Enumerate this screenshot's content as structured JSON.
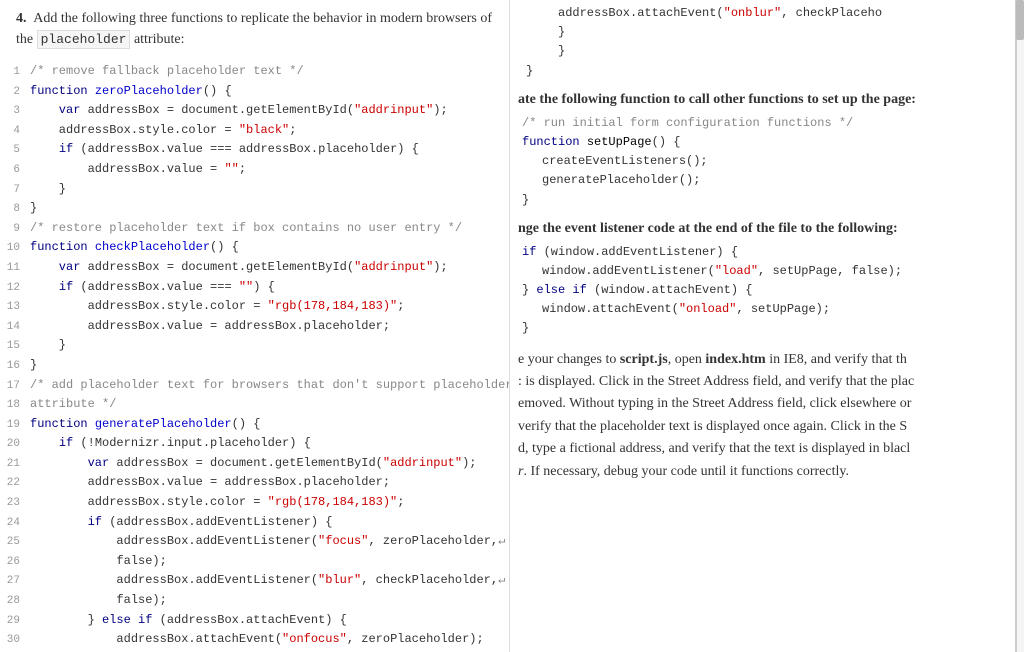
{
  "left": {
    "intro": {
      "step": "4.",
      "text1": "Add the following three functions to replicate the behavior in modern browsers of the",
      "code_word": "placeholder",
      "text2": "attribute:"
    },
    "lines": [
      {
        "num": "1",
        "tokens": [
          {
            "t": "/* remove fallback placeholder text */",
            "c": "cm"
          }
        ]
      },
      {
        "num": "2",
        "tokens": [
          {
            "t": "function ",
            "c": "kw"
          },
          {
            "t": "zeroPlaceholder",
            "c": "fn"
          },
          {
            "t": "() {",
            "c": ""
          }
        ]
      },
      {
        "num": "3",
        "tokens": [
          {
            "t": "    var ",
            "c": "kw"
          },
          {
            "t": "addressBox",
            "c": ""
          },
          {
            "t": " = ",
            "c": ""
          },
          {
            "t": "document",
            "c": ""
          },
          {
            "t": ".getElementById(",
            "c": ""
          },
          {
            "t": "\"addrinput\"",
            "c": "str"
          },
          {
            "t": ");",
            "c": ""
          }
        ]
      },
      {
        "num": "4",
        "tokens": [
          {
            "t": "    addressBox.style.color = ",
            "c": ""
          },
          {
            "t": "\"black\"",
            "c": "str"
          },
          {
            "t": ";",
            "c": ""
          }
        ]
      },
      {
        "num": "5",
        "tokens": [
          {
            "t": "    ",
            "c": ""
          },
          {
            "t": "if",
            "c": "kw"
          },
          {
            "t": " (addressBox.value ",
            "c": ""
          },
          {
            "t": "===",
            "c": ""
          },
          {
            "t": " addressBox.placeholder) {",
            "c": ""
          }
        ]
      },
      {
        "num": "6",
        "tokens": [
          {
            "t": "        addressBox.value = ",
            "c": ""
          },
          {
            "t": "\"\"",
            "c": "str"
          },
          {
            "t": ";",
            "c": ""
          }
        ]
      },
      {
        "num": "7",
        "tokens": [
          {
            "t": "    }",
            "c": ""
          }
        ]
      },
      {
        "num": "8",
        "tokens": [
          {
            "t": "}",
            "c": ""
          }
        ]
      },
      {
        "num": "9",
        "tokens": [
          {
            "t": "/* restore placeholder text if box contains no user entry */",
            "c": "cm"
          }
        ]
      },
      {
        "num": "10",
        "tokens": [
          {
            "t": "function ",
            "c": "kw"
          },
          {
            "t": "checkPlaceholder",
            "c": "fn"
          },
          {
            "t": "() {",
            "c": ""
          }
        ]
      },
      {
        "num": "11",
        "tokens": [
          {
            "t": "    var ",
            "c": "kw"
          },
          {
            "t": "addressBox",
            "c": ""
          },
          {
            "t": " = ",
            "c": ""
          },
          {
            "t": "document",
            "c": ""
          },
          {
            "t": ".getElementById(",
            "c": ""
          },
          {
            "t": "\"addrinput\"",
            "c": "str"
          },
          {
            "t": ");",
            "c": ""
          }
        ]
      },
      {
        "num": "12",
        "tokens": [
          {
            "t": "    ",
            "c": ""
          },
          {
            "t": "if",
            "c": "kw"
          },
          {
            "t": " (addressBox.value ",
            "c": ""
          },
          {
            "t": "===",
            "c": ""
          },
          {
            "t": " ",
            "c": ""
          },
          {
            "t": "\"\"",
            "c": "str"
          },
          {
            "t": ") {",
            "c": ""
          }
        ]
      },
      {
        "num": "13",
        "tokens": [
          {
            "t": "        addressBox.style.color = ",
            "c": ""
          },
          {
            "t": "\"rgb(178,184,183)\"",
            "c": "str"
          },
          {
            "t": ";",
            "c": ""
          }
        ]
      },
      {
        "num": "14",
        "tokens": [
          {
            "t": "        addressBox.value = addressBox.placeholder;",
            "c": ""
          }
        ]
      },
      {
        "num": "15",
        "tokens": [
          {
            "t": "    }",
            "c": ""
          }
        ]
      },
      {
        "num": "16",
        "tokens": [
          {
            "t": "}",
            "c": ""
          }
        ]
      },
      {
        "num": "17",
        "tokens": [
          {
            "t": "/* add placeholder text for browsers that don't support placeholder",
            "c": "cm"
          }
        ]
      },
      {
        "num": "18",
        "tokens": [
          {
            "t": "attribute */",
            "c": "cm"
          }
        ]
      },
      {
        "num": "19",
        "tokens": [
          {
            "t": "function ",
            "c": "kw"
          },
          {
            "t": "generatePlaceholder",
            "c": "fn"
          },
          {
            "t": "() {",
            "c": ""
          }
        ]
      },
      {
        "num": "20",
        "tokens": [
          {
            "t": "    ",
            "c": ""
          },
          {
            "t": "if",
            "c": "kw"
          },
          {
            "t": " (!Modernizr.input.placeholder) {",
            "c": ""
          }
        ]
      },
      {
        "num": "21",
        "tokens": [
          {
            "t": "        var ",
            "c": "kw"
          },
          {
            "t": "addressBox",
            "c": ""
          },
          {
            "t": " = ",
            "c": ""
          },
          {
            "t": "document",
            "c": ""
          },
          {
            "t": ".getElementById(",
            "c": ""
          },
          {
            "t": "\"addrinput\"",
            "c": "str"
          },
          {
            "t": ");",
            "c": ""
          }
        ]
      },
      {
        "num": "22",
        "tokens": [
          {
            "t": "        addressBox.value = addressBox.placeholder;",
            "c": ""
          }
        ]
      },
      {
        "num": "23",
        "tokens": [
          {
            "t": "        addressBox.style.color = ",
            "c": ""
          },
          {
            "t": "\"rgb(178,184,183)\"",
            "c": "str"
          },
          {
            "t": ";",
            "c": ""
          }
        ]
      },
      {
        "num": "24",
        "tokens": [
          {
            "t": "        ",
            "c": ""
          },
          {
            "t": "if",
            "c": "kw"
          },
          {
            "t": " (addressBox.addEventListener) {",
            "c": ""
          }
        ]
      },
      {
        "num": "25",
        "tokens": [
          {
            "t": "            addressBox.addEventListener(",
            "c": ""
          },
          {
            "t": "\"focus\"",
            "c": "str"
          },
          {
            "t": ", zeroPlaceholder,",
            "c": ""
          },
          {
            "t": "↵",
            "c": "cm"
          }
        ]
      },
      {
        "num": "26",
        "tokens": [
          {
            "t": "            false);",
            "c": ""
          }
        ]
      },
      {
        "num": "27",
        "tokens": [
          {
            "t": "            addressBox.addEventListener(",
            "c": ""
          },
          {
            "t": "\"blur\"",
            "c": "str"
          },
          {
            "t": ", checkPlaceholder,",
            "c": ""
          },
          {
            "t": "↵",
            "c": "cm"
          }
        ]
      },
      {
        "num": "28",
        "tokens": [
          {
            "t": "            false);",
            "c": ""
          }
        ]
      },
      {
        "num": "29",
        "tokens": [
          {
            "t": "        } ",
            "c": ""
          },
          {
            "t": "else if",
            "c": "kw"
          },
          {
            "t": " (addressBox.attachEvent) {",
            "c": ""
          }
        ]
      },
      {
        "num": "30",
        "tokens": [
          {
            "t": "            addressBox.attachEvent(",
            "c": ""
          },
          {
            "t": "\"onfocus\"",
            "c": "str"
          },
          {
            "t": ", zeroPlaceholder);",
            "c": ""
          }
        ]
      }
    ]
  },
  "right": {
    "code_top": [
      "            addressBox.attachEvent(\"onblur\", checkPlaceho",
      "        }",
      "    }",
      "}"
    ],
    "section1_heading": "ate the following function to call other functions to set up the page:",
    "section1_code": [
      {
        "indent": 0,
        "tokens": [
          {
            "t": "/* run initial form configuration functions */",
            "c": "cm"
          }
        ]
      },
      {
        "indent": 0,
        "tokens": [
          {
            "t": "function ",
            "c": "kw"
          },
          {
            "t": "setUpPage",
            "c": "fn"
          },
          {
            "t": "() {",
            "c": ""
          }
        ]
      },
      {
        "indent": 1,
        "tokens": [
          {
            "t": "createEventListeners();",
            "c": ""
          }
        ]
      },
      {
        "indent": 1,
        "tokens": [
          {
            "t": "generatePlaceholder();",
            "c": ""
          }
        ]
      },
      {
        "indent": 0,
        "tokens": [
          {
            "t": "}",
            "c": ""
          }
        ]
      }
    ],
    "section2_heading": "nge the event listener code at the end of the file to the following:",
    "section2_code": [
      {
        "indent": 0,
        "tokens": [
          {
            "t": "if",
            "c": "kw"
          },
          {
            "t": " (window.addEventListener) {",
            "c": ""
          }
        ]
      },
      {
        "indent": 1,
        "tokens": [
          {
            "t": "window.addEventListener(",
            "c": ""
          },
          {
            "t": "\"load\"",
            "c": "str"
          },
          {
            "t": ", setUpPage, false);",
            "c": ""
          }
        ]
      },
      {
        "indent": 0,
        "tokens": [
          {
            "t": "} ",
            "c": ""
          },
          {
            "t": "else if",
            "c": "kw"
          },
          {
            "t": " (window.attachEvent) {",
            "c": ""
          }
        ]
      },
      {
        "indent": 1,
        "tokens": [
          {
            "t": "window.attachEvent(",
            "c": ""
          },
          {
            "t": "\"onload\"",
            "c": "str"
          },
          {
            "t": ", setUpPage);",
            "c": ""
          }
        ]
      },
      {
        "indent": 0,
        "tokens": [
          {
            "t": "}",
            "c": ""
          }
        ]
      }
    ],
    "section3_text": "e your changes to script.js, open index.htm in IE8, and verify that th",
    "section3_text2": ": is displayed. Click in the Street Address field, and verify that the plac",
    "section3_text3": "emoved. Without typing in the Street Address field, click elsewhere or",
    "section3_text4": "verify that the placeholder text is displayed once again. Click in the S",
    "section3_text5": "d, type a fictional address, and verify that the text is displayed in blacl",
    "section3_text6": "r. If necessary, debug your code until it functions correctly."
  }
}
